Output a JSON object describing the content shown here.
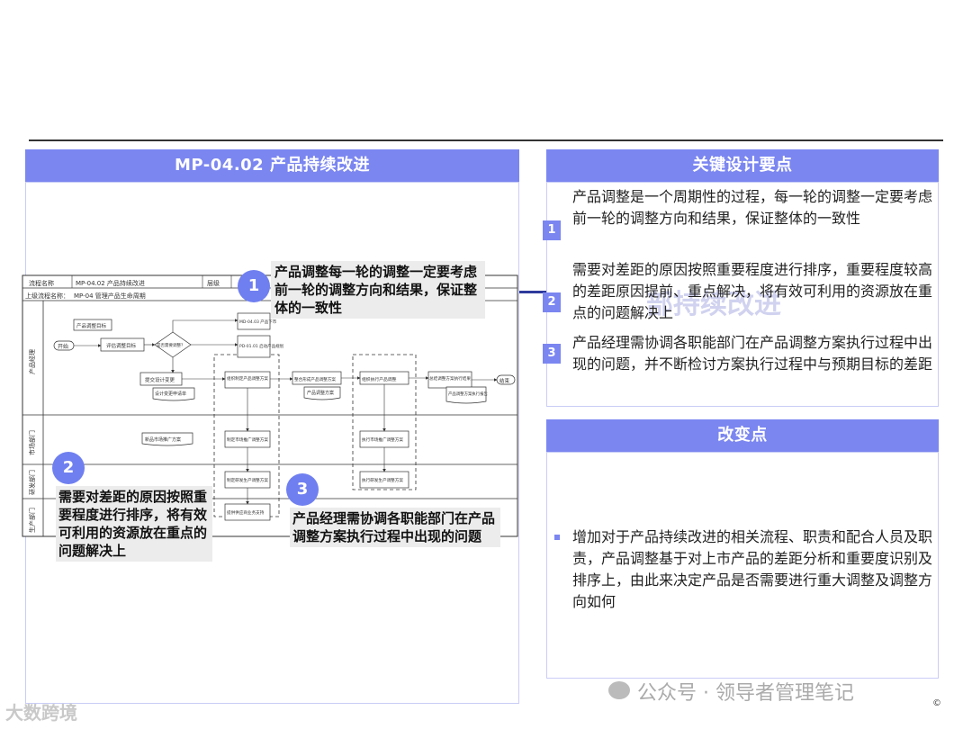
{
  "left_panel": {
    "title": "MP-04.02 产品持续改进"
  },
  "flowchart": {
    "row1_label": "流程名称",
    "row1_value": "MP-04.02 产品持续改进",
    "row1_label2": "层级",
    "row2_label": "上级流程名称：",
    "row2_value": "MP-04 管理产品生命周期",
    "lanes": [
      "产品经理",
      "市场部门",
      "研发部门",
      "生产部门"
    ],
    "start": "开始",
    "end": "结束",
    "boxes": {
      "b_review_goal": "产品调整目标",
      "b_eval_goal": "评估调整目标",
      "b_decision": "是否需要调整？",
      "b_md0403": "MD-04.03 产品下市",
      "b_pd0101": "PD-01.01 启动产品规划",
      "b_submit": "提交设计变更",
      "b_design_change": "设计变更申请单",
      "b_make_plan": "组织制定产品调整方案",
      "b_plan_doc": "方案",
      "b_aggregate": "整合形成产品调整方案",
      "b_product_plan": "产品调整方案",
      "b_org_exec": "组织执行产品调整",
      "b_summary": "总结调整方案执行结果",
      "b_report": "产品调整方案执行报告",
      "b_market_plan": "新品市场推广方案",
      "b_market_make": "制定市场推广调整方案",
      "b_market_exec": "执行市场推广调整方案",
      "b_rd_make": "制定研发生产调整方案",
      "b_rd_exec": "执行研发生产调整方案",
      "b_prod_make": "提供供应商业务支持"
    }
  },
  "callouts": [
    {
      "num": "1",
      "text": "产品调整每一轮的调整一定要考虑前一轮的调整方向和结果，保证整体的一致性"
    },
    {
      "num": "2",
      "text": "需要对差距的原因按照重要程度进行排序，将有效可利用的资源放在重点的问题解决上"
    },
    {
      "num": "3",
      "text": "产品经理需协调各职能部门在产品调整方案执行过程中出现的问题"
    }
  ],
  "key_points": {
    "title": "关键设计要点",
    "items": [
      {
        "num": "1",
        "text": "产品调整是一个周期性的过程，每一轮的调整一定要考虑前一轮的调整方向和结果，保证整体的一致性"
      },
      {
        "num": "2",
        "text": "需要对差距的原因按照重要程度进行排序，重要程度较高的差距原因提前、重点解决，将有效可利用的资源放在重点的问题解决上"
      },
      {
        "num": "3",
        "text": "产品经理需协调各职能部门在产品调整方案执行过程中出现的问题，并不断检讨方案执行过程中与预期目标的差距"
      }
    ],
    "ghost_text": "部持续改进"
  },
  "changes": {
    "title": "改变点",
    "items": [
      {
        "text": "增加对于产品持续改进的相关流程、职责和配合人员及职责，产品调整基于对上市产品的差距分析和重要度识别及排序上，由此来决定产品是否需要进行重大调整及调整方向如何"
      }
    ]
  },
  "watermarks": {
    "wechat": "公众号 · 领导者管理笔记",
    "left": "大数跨境",
    "copyright": "©"
  },
  "colors": {
    "header": "#7b86f0",
    "callout_circle": "#6f7ff0",
    "callout_bg": "#ececec",
    "border": "#c9cdf6"
  }
}
